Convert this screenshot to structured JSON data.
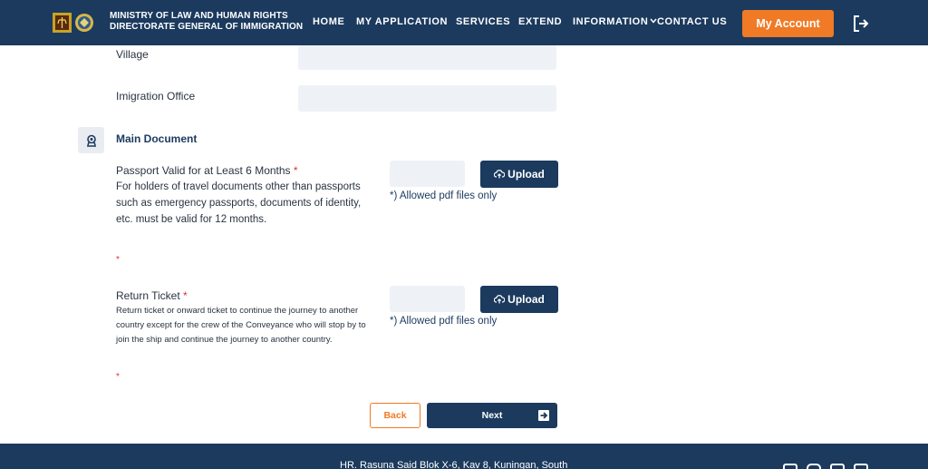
{
  "header": {
    "brand_line1": "MINISTRY OF  LAW  AND HUMAN RIGHTS",
    "brand_line2": "DIRECTORATE GENERAL OF IMMIGRATION",
    "nav": {
      "home": "HOME",
      "my_application": "MY APPLICATION",
      "services": "SERVICES",
      "extend": "EXTEND",
      "information": "INFORMATION",
      "contact_us": "CONTACT US"
    },
    "account_button": "My Account"
  },
  "form": {
    "village_label": "Village",
    "village_value": "",
    "imigration_office_label": "Imigration Office",
    "imigration_office_value": ""
  },
  "main_document": {
    "title": "Main Document",
    "passport": {
      "title": "Passport Valid for at Least 6 Months",
      "required_mark": "*",
      "description": "For holders of travel documents other than passports such as emergency passports, documents of identity, etc. must be valid for 12 months.",
      "upload_label": "Upload",
      "allowed_note": "*) Allowed pdf files only"
    },
    "return_ticket": {
      "title": "Return Ticket",
      "required_mark": "*",
      "description": "Return ticket or onward ticket to continue the journey to another country except for the crew of the Conveyance who will stop by to join the ship and continue the journey to another country.",
      "upload_label": "Upload",
      "allowed_note": "*) Allowed pdf files only"
    }
  },
  "actions": {
    "back": "Back",
    "next": "Next"
  },
  "footer": {
    "address": "HR. Rasuna Said Blok X-6, Kav 8, Kuningan, South"
  },
  "colors": {
    "primary": "#1b3a5e",
    "accent": "#f07a26",
    "required": "#e03131",
    "input_bg": "#eef2f7"
  }
}
